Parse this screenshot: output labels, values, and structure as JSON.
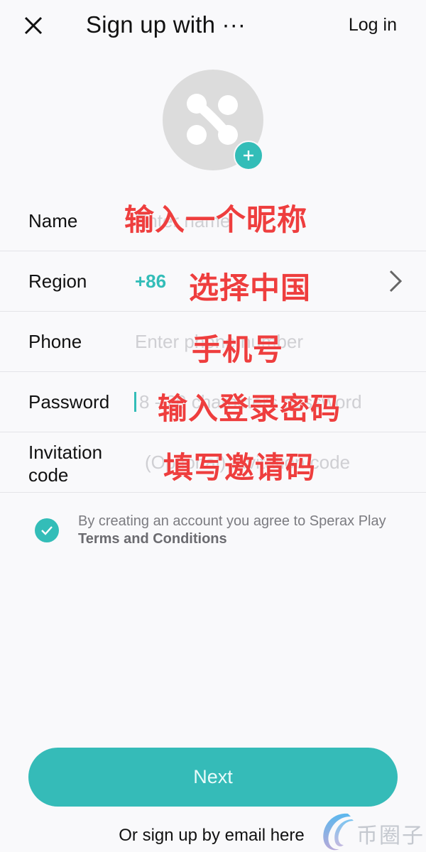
{
  "header": {
    "title": "Sign up with ···",
    "login_label": "Log in",
    "close_icon": "close-icon"
  },
  "avatar": {
    "icon": "app-logo-icon",
    "add_icon": "plus-icon"
  },
  "form": {
    "name": {
      "label": "Name",
      "placeholder": "Enter name",
      "annotation": "输入一个昵称"
    },
    "region": {
      "label": "Region",
      "value": "+86",
      "annotation": "选择中国",
      "chevron_icon": "chevron-right-icon"
    },
    "phone": {
      "label": "Phone",
      "placeholder": "Enter phone number",
      "annotation": "手机号"
    },
    "password": {
      "label": "Password",
      "placeholder": "8 - 20 characters password",
      "annotation": "输入登录密码"
    },
    "invitation": {
      "label_line1": "Invitation",
      "label_line2": "code",
      "placeholder": "(Optional) Invitation code",
      "annotation": "填写邀请码"
    }
  },
  "terms": {
    "checked": true,
    "text": "By creating an account you agree to Sperax Play",
    "link": "Terms and Conditions"
  },
  "actions": {
    "next_label": "Next",
    "email_link": "Or sign up by email here"
  },
  "watermark": {
    "text": "币圈子"
  },
  "colors": {
    "accent": "#35bbb8",
    "annotation": "#ee3e3e",
    "placeholder": "#cfcfd3"
  }
}
